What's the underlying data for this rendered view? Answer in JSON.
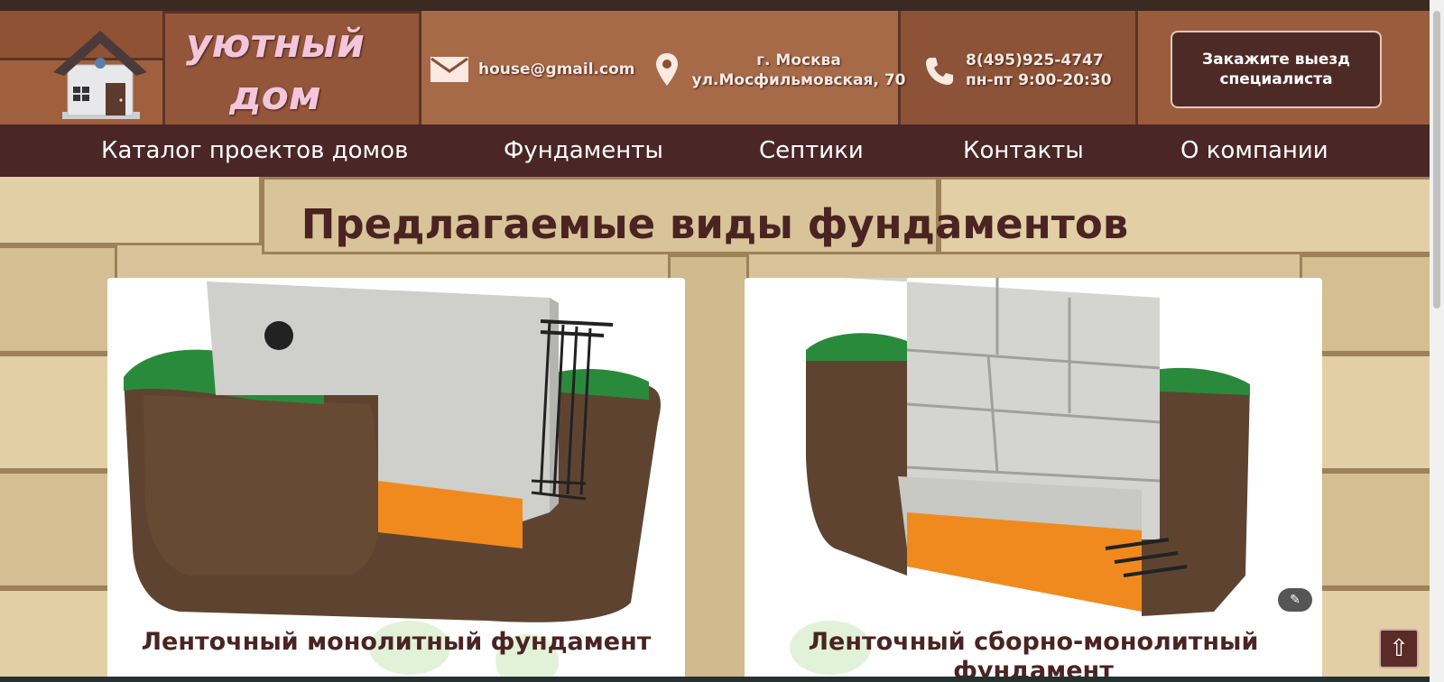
{
  "logo": {
    "line1": "уютный",
    "line2": "дом"
  },
  "contact": {
    "email": "house@gmail.com",
    "address_city": "г. Москва",
    "address_street": "ул.Мосфильмовская, 70",
    "phone": "8(495)925-4747",
    "hours": "пн-пт 9:00-20:30"
  },
  "cta": {
    "line1": "Закажите выезд",
    "line2": "специалиста"
  },
  "nav": {
    "items": [
      {
        "label": "Каталог проектов домов"
      },
      {
        "label": "Фундаменты"
      },
      {
        "label": "Септики"
      },
      {
        "label": "Контакты"
      },
      {
        "label": "О компании"
      }
    ]
  },
  "main": {
    "heading": "Предлагаемые виды фундаментов",
    "cards": [
      {
        "title": "Ленточный монолитный фундамент"
      },
      {
        "title": "Ленточный сборно-монолитный фундамент"
      }
    ]
  },
  "colors": {
    "nav_bg": "#4a2626",
    "heading": "#4b2323",
    "cta_bg": "#4e2a26"
  },
  "icons": [
    "house-logo-icon",
    "envelope-icon",
    "map-pin-icon",
    "phone-icon",
    "magic-wand-icon",
    "arrow-up-icon"
  ]
}
